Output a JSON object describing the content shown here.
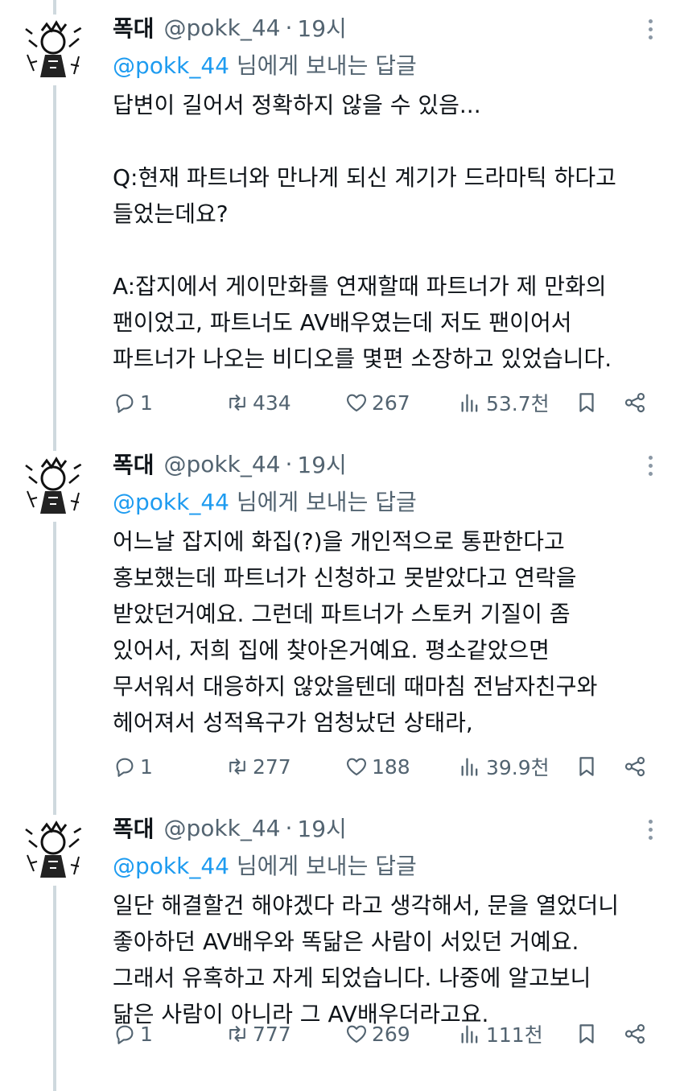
{
  "colors": {
    "link": "#1d9bf0",
    "secondary": "#536471",
    "thread_line": "#cfd9de"
  },
  "tweets": [
    {
      "name": "폭대",
      "handle": "@pokk_44",
      "dot": "·",
      "time": "19시",
      "reply_handle": "@pokk_44",
      "reply_suffix": " 님에게 보내는 답글",
      "text": "답변이 길어서 정확하지 않을 수 있음...\n\nQ:현재 파트너와 만나게 되신 계기가 드라마틱 하다고\n들었는데요?\n\nA:잡지에서 게이만화를 연재할때 파트너가 제 만화의\n팬이었고, 파트너도 AV배우였는데 저도 팬이어서\n파트너가 나오는 비디오를 몇편 소장하고 있었습니다.",
      "replies": "1",
      "retweets": "434",
      "likes": "267",
      "views": "53.7천"
    },
    {
      "name": "폭대",
      "handle": "@pokk_44",
      "dot": "·",
      "time": "19시",
      "reply_handle": "@pokk_44",
      "reply_suffix": " 님에게 보내는 답글",
      "text": "어느날 잡지에 화집(?)을 개인적으로 통판한다고\n홍보했는데 파트너가 신청하고 못받았다고 연락을\n받았던거예요. 그런데 파트너가 스토커 기질이 좀\n있어서, 저희 집에 찾아온거예요. 평소같았으면\n무서워서 대응하지 않았을텐데 때마침 전남자친구와\n헤어져서 성적욕구가 엄청났던 상태라,",
      "replies": "1",
      "retweets": "277",
      "likes": "188",
      "views": "39.9천"
    },
    {
      "name": "폭대",
      "handle": "@pokk_44",
      "dot": "·",
      "time": "19시",
      "reply_handle": "@pokk_44",
      "reply_suffix": " 님에게 보내는 답글",
      "text": "일단 해결할건 해야겠다 라고 생각해서, 문을 열었더니\n좋아하던 AV배우와 똑닮은 사람이 서있던 거예요.\n그래서 유혹하고 자게 되었습니다. 나중에 알고보니\n닮은 사람이 아니라 그 AV배우더라고요.",
      "replies": "1",
      "retweets": "777",
      "likes": "269",
      "views": "111천"
    }
  ]
}
